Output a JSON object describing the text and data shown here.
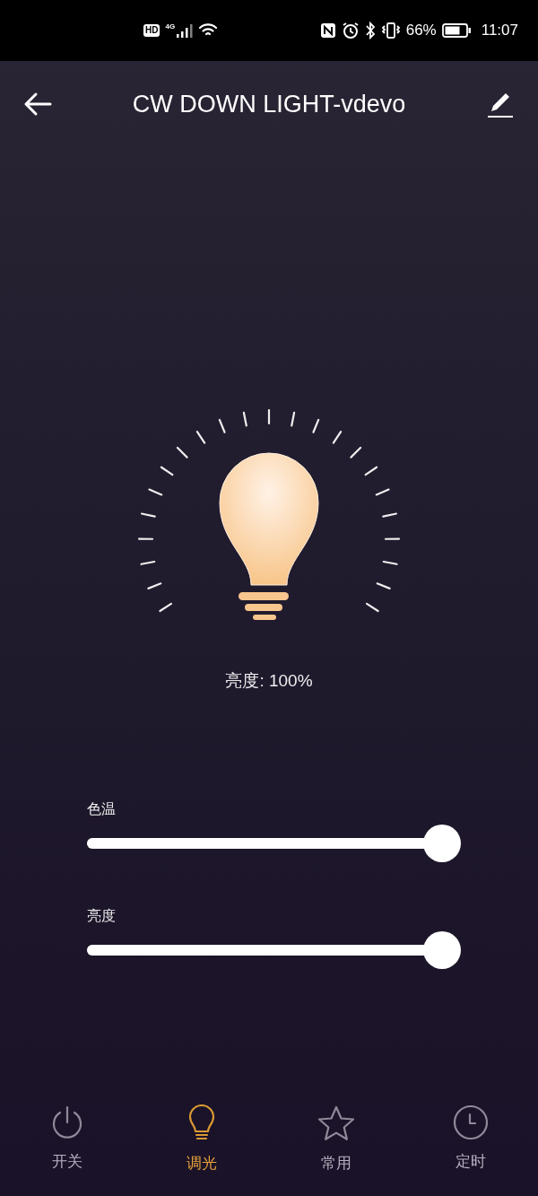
{
  "status_bar": {
    "hd": "HD",
    "network": "4G",
    "battery": "66%",
    "time": "11:07"
  },
  "header": {
    "title": "CW DOWN LIGHT-vdevo"
  },
  "lamp": {
    "on": true,
    "reading": "亮度: 100%"
  },
  "sliders": [
    {
      "label": "色温",
      "level": 1
    },
    {
      "label": "亮度",
      "level": 1
    }
  ],
  "tabs": [
    {
      "kind": "power",
      "label": "开关",
      "selected": false
    },
    {
      "kind": "bulb",
      "label": "调光",
      "selected": true
    },
    {
      "kind": "star",
      "label": "常用",
      "selected": false
    },
    {
      "kind": "clock",
      "label": "定时",
      "selected": false
    }
  ]
}
